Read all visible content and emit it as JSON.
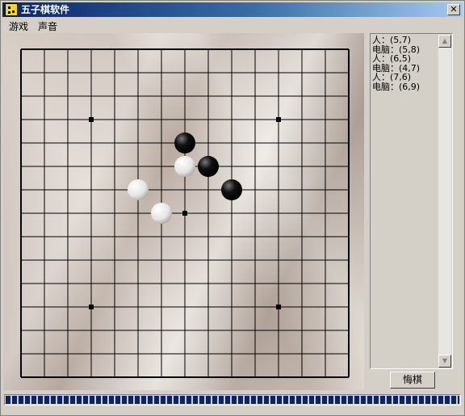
{
  "window": {
    "title": "五子棋软件",
    "close_symbol": "✕"
  },
  "menu": [
    {
      "label": "游戏"
    },
    {
      "label": "声音"
    }
  ],
  "board": {
    "size": 15,
    "star_points": [
      [
        3,
        3
      ],
      [
        11,
        3
      ],
      [
        7,
        7
      ],
      [
        3,
        11
      ],
      [
        11,
        11
      ]
    ],
    "stones": [
      {
        "color": "black",
        "col": 7,
        "row": 4
      },
      {
        "color": "white",
        "col": 7,
        "row": 5
      },
      {
        "color": "black",
        "col": 8,
        "row": 5
      },
      {
        "color": "black",
        "col": 9,
        "row": 6
      },
      {
        "color": "white",
        "col": 5,
        "row": 6
      },
      {
        "color": "white",
        "col": 6,
        "row": 7
      }
    ]
  },
  "move_log": [
    "人：(5,7)",
    "电脑：(5,8)",
    "人：(6,5)",
    "电脑：(4,7)",
    "人：(7,6)",
    "电脑：(6,9)"
  ],
  "scrollbar": {
    "up_symbol": "▲",
    "down_symbol": "▼"
  },
  "undo_button": {
    "label": "悔棋"
  },
  "progress": {
    "value": 1.0
  }
}
